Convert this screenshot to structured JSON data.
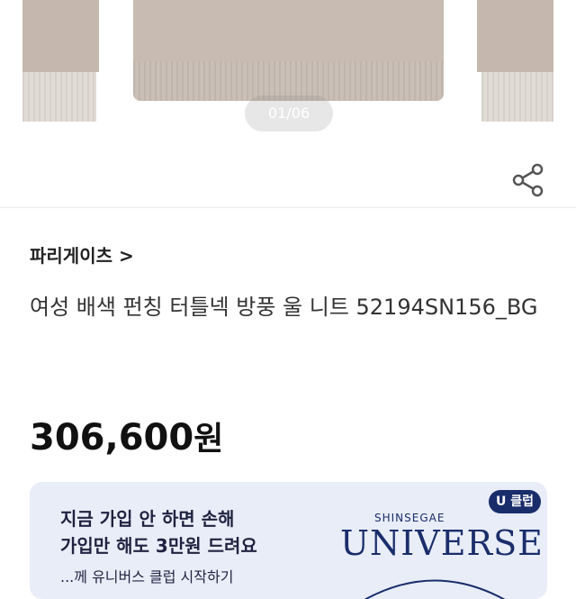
{
  "gallery": {
    "indicator": "01/06"
  },
  "share": {
    "icon": "share-icon"
  },
  "product": {
    "brand": "파리게이츠 >",
    "title": "여성 배색 펀칭 터틀넥 방풍 울 니트 52194SN156_BG",
    "price_amount": "306,600",
    "price_unit": "원"
  },
  "promo": {
    "line1": "지금 가입 안 하면 손해",
    "line2": "가입만 해도 3만원 드려요",
    "line3": "...께 유니버스 클럽 시작하기",
    "badge": "U 클럽",
    "brand_small": "SHINSEGAE",
    "brand_large": "UNIVERSE"
  },
  "colors": {
    "banner_bg": "#e8edf8",
    "brand_navy": "#1a2d6b",
    "sweater": "#c8bbb2"
  }
}
